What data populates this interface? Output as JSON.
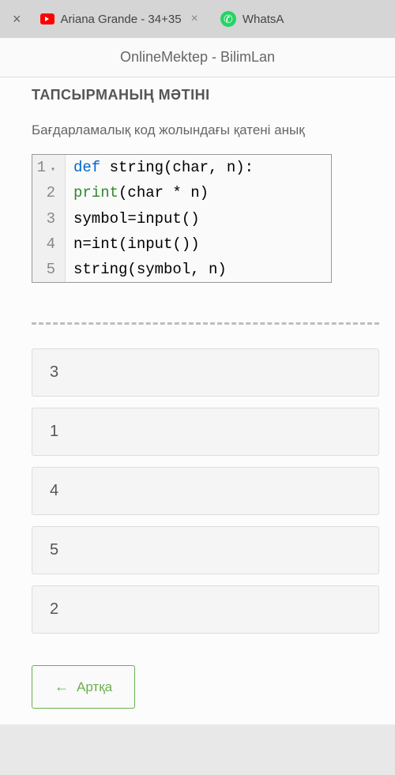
{
  "browser": {
    "tab1_title": "Ariana Grande - 34+35",
    "tab2_title": "WhatsA"
  },
  "page_title": "OnlineMektep - BilimLan",
  "task": {
    "header": "ТАПСЫРМАНЫҢ МƏТІНІ",
    "question": "Бағдарламалық код жолындағы қатені анық"
  },
  "code": {
    "lines": [
      {
        "num": "1",
        "kw": "def",
        "text": " string(char, n):"
      },
      {
        "num": "2",
        "fn": "print",
        "text": "(char * n)"
      },
      {
        "num": "3",
        "text": "symbol=input()"
      },
      {
        "num": "4",
        "text": "n=int(input())"
      },
      {
        "num": "5",
        "text": "string(symbol, n)"
      }
    ]
  },
  "answers": [
    "3",
    "1",
    "4",
    "5",
    "2"
  ],
  "back_label": "Артқа"
}
